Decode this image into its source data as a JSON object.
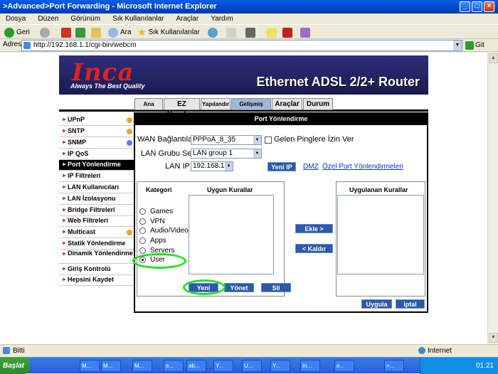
{
  "window": {
    "title": ">Advanced>Port Forwarding - Microsoft Internet Explorer"
  },
  "menu": [
    "Dosya",
    "Düzen",
    "Görünüm",
    "Sık Kullanılanlar",
    "Araçlar",
    "Yardım"
  ],
  "toolbar": {
    "back": "Geri",
    "search": "Ara",
    "favorites": "Sık Kullanılanlar"
  },
  "address": {
    "label": "Adres",
    "url": "http://192.168.1.1/cgi-bin/webcm",
    "go": "Git"
  },
  "router": {
    "logo": "Inca",
    "slogan": "Always The Best Quality",
    "product": "Ethernet ADSL 2/2+ Router",
    "tabs": [
      "Ana Sayfa",
      "EZ Kurulum",
      "Yapılandır",
      "Gelişmiş",
      "Araçlar",
      "Durum"
    ],
    "sidebar": [
      "UPnP",
      "SNTP",
      "SNMP",
      "IP QoS",
      "Port Yönlendirme",
      "IP Filtreleri",
      "LAN Kullanıcıları",
      "LAN İzolasyonu",
      "Bridge Filtreleri",
      "Web Filtreleri",
      "Multicast",
      "Statik Yönlendirme",
      "Dinamik Yönlendirme",
      "Giriş Kontrolü",
      "Hepsini Kaydet"
    ],
    "panel_title": "Port Yönlendirme",
    "wan_label": "WAN Bağlantıları:",
    "wan_value": "PPPoA_8_35",
    "ping_label": "Gelen Pinglere İzin Ver",
    "lan_group_label": "LAN Grubu Seç:",
    "lan_group_value": "LAN group 1",
    "lan_ip_label": "LAN IP:",
    "lan_ip_value": "192.168.1.2",
    "new_ip": "Yeni IP",
    "dmz": "DMZ",
    "custom_pf": "Özel Port Yönlendirmeleri",
    "category_hdr": "Kategori",
    "available_hdr": "Uygun Kurallar",
    "applied_hdr": "Uygulanan Kurallar",
    "categories": [
      "Games",
      "VPN",
      "Audio/Video",
      "Apps",
      "Servers",
      "User"
    ],
    "add": "Ekle >",
    "remove": "< Kaldır",
    "new": "Yeni",
    "manage": "Yönet",
    "delete": "Sil",
    "apply": "Uygula",
    "cancel": "iptal"
  },
  "status": {
    "left": "Bitti",
    "zone": "Internet"
  },
  "taskbar": {
    "start": "Başlat",
    "time": "01:21",
    "tasks": [
      "M...",
      "M...",
      "M...",
      "e...",
      "ab...",
      "Y...",
      "U...",
      "Y...",
      "In...",
      "e...",
      ">..."
    ]
  }
}
